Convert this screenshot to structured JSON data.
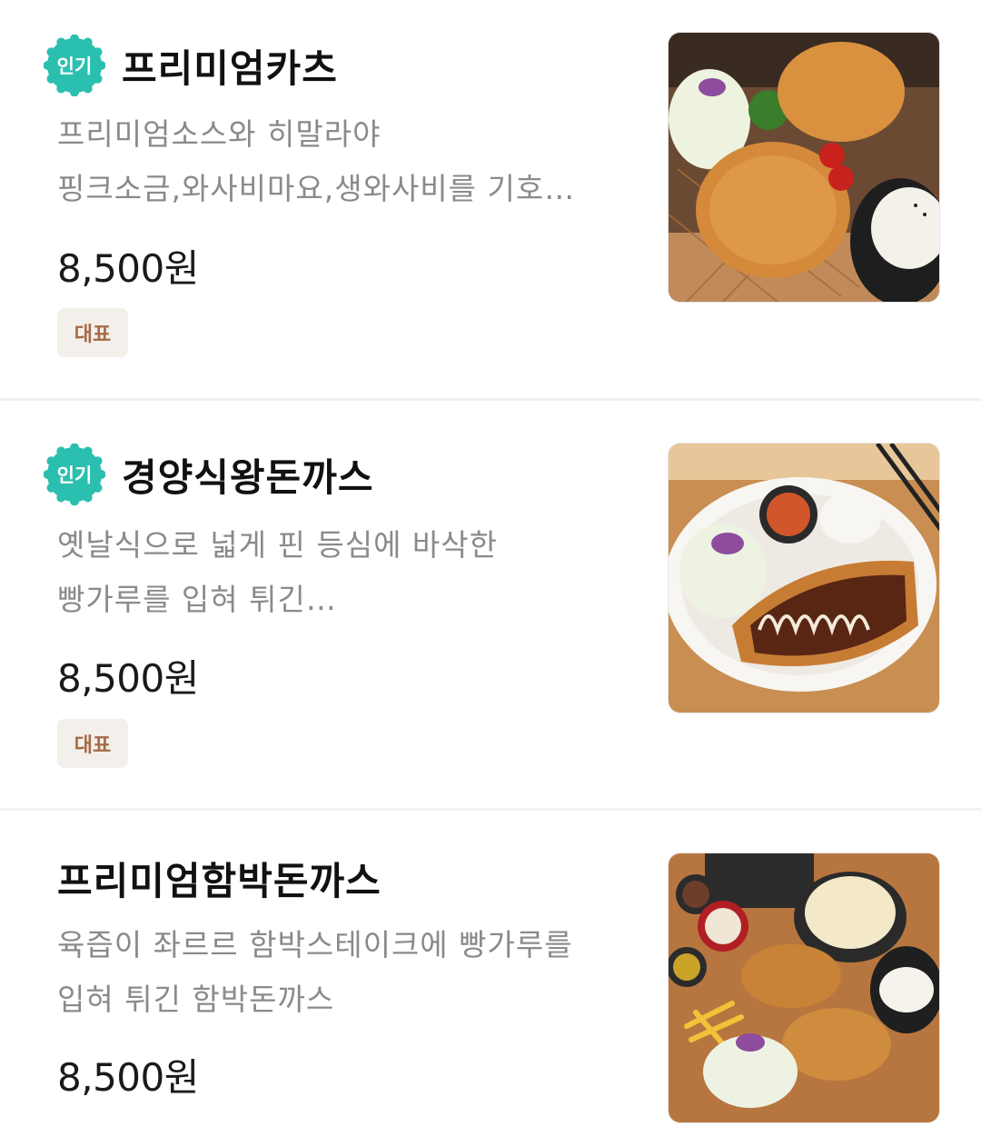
{
  "menu": {
    "items": [
      {
        "badge": "인기",
        "name": "프리미엄카츠",
        "desc_lines": [
          "프리미엄소스와 히말라야",
          "핑크소금,와사비마요,생와사비를 기호…"
        ],
        "price": "8,500원",
        "tag": "대표",
        "image_icon": "premium-katsu-photo-icon"
      },
      {
        "badge": "인기",
        "name": "경양식왕돈까스",
        "desc_lines": [
          "옛날식으로 넓게 핀 등심에 바삭한",
          "빵가루를 입혀 튀긴…"
        ],
        "price": "8,500원",
        "tag": "대표",
        "image_icon": "king-donkatsu-photo-icon"
      },
      {
        "name": "프리미엄함박돈까스",
        "desc_lines": [
          "육즙이 좌르르 함박스테이크에 빵가루를",
          "입혀 튀긴 함박돈까스"
        ],
        "price": "8,500원",
        "image_icon": "hambak-donkatsu-photo-icon"
      }
    ]
  },
  "colors": {
    "badge": "#2bbfb0",
    "tag_bg": "#f3efea",
    "tag_text": "#a36a44",
    "desc": "#8a8a8a"
  }
}
